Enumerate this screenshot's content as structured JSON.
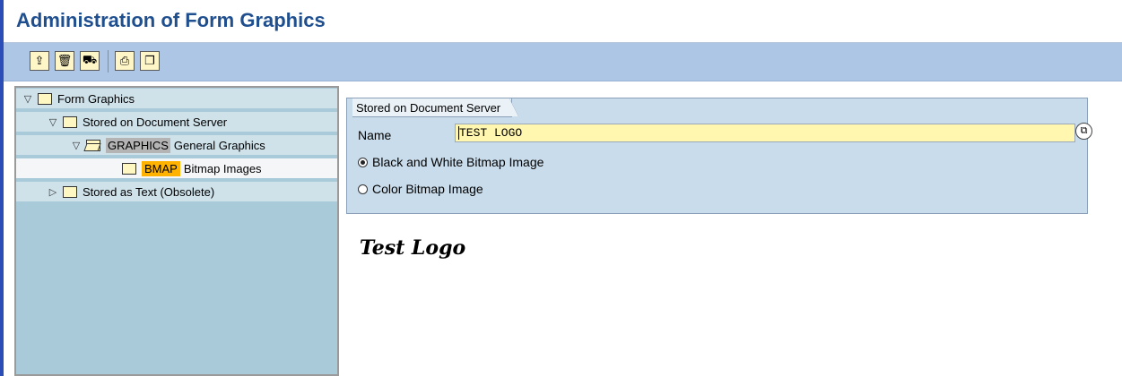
{
  "page_title": "Administration of Form Graphics",
  "toolbar": {
    "buttons": [
      {
        "icon": "import-icon"
      },
      {
        "icon": "delete-icon"
      },
      {
        "icon": "transport-icon"
      },
      {
        "icon": "print-preview-icon"
      },
      {
        "icon": "details-icon"
      }
    ]
  },
  "tree": {
    "items": [
      {
        "label": "Form Graphics"
      },
      {
        "label": "Stored on Document Server"
      },
      {
        "key": "GRAPHICS",
        "label": "General Graphics"
      },
      {
        "key": "BMAP",
        "label": "Bitmap Images"
      },
      {
        "label": "Stored as Text (Obsolete)"
      }
    ]
  },
  "detail": {
    "tab_label": "Stored on Document Server",
    "name_label": "Name",
    "name_value": "TEST LOGO",
    "radio_bw": "Black and White Bitmap Image",
    "radio_color": "Color Bitmap Image",
    "selected": "bw"
  },
  "preview": {
    "logo_text": "Test Logo"
  },
  "colors": {
    "title": "#1f4f8f",
    "toolbar": "#aec6e6",
    "tree_bg": "#a9cad8",
    "input_bg": "#fff7b0",
    "key_highlight": "#ffb300"
  }
}
